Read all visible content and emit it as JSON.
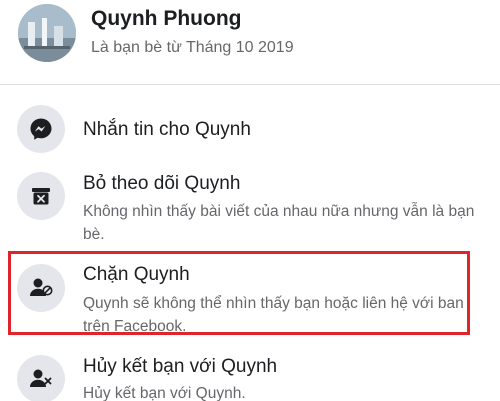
{
  "profile": {
    "name": "Quynh Phuong",
    "friends_since": "Là bạn bè từ Tháng 10 2019"
  },
  "menu": [
    {
      "title": "Nhắn tin cho Quynh",
      "description": "",
      "icon": "messenger-icon"
    },
    {
      "title": "Bỏ theo dõi Quynh",
      "description": "Không nhìn thấy bài viết của nhau nữa nhưng vẫn là bạn bè.",
      "icon": "unfollow-icon"
    },
    {
      "title": "Chặn Quynh",
      "description": "Quynh sẽ không thể nhìn thấy bạn hoặc liên hệ với ban trên Facebook.",
      "icon": "block-user-icon"
    },
    {
      "title": "Hủy kết bạn với Quynh",
      "description": "Hủy kết bạn với Quynh.",
      "icon": "unfriend-icon"
    }
  ],
  "colors": {
    "highlight": "#e0242c",
    "icon_bg": "#e4e6eb",
    "secondary_text": "#65676b"
  }
}
